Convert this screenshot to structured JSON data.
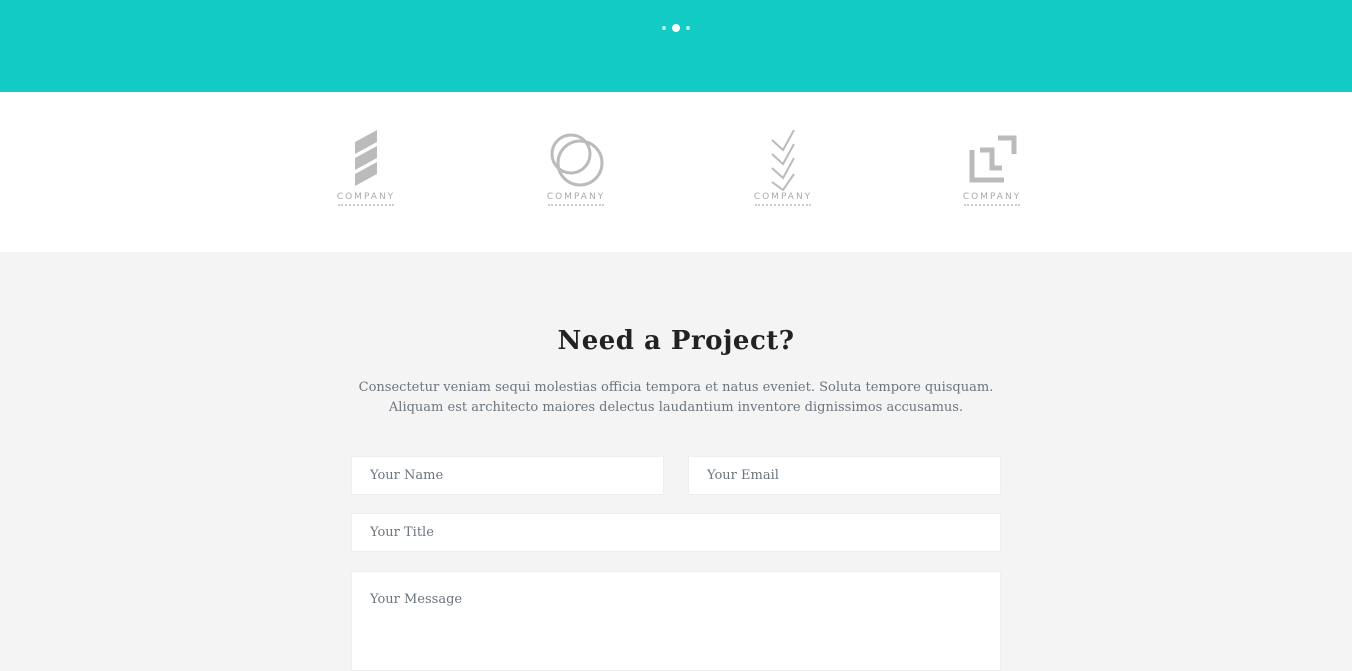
{
  "hero": {
    "background": "#12cbc4",
    "carousel_dots": [
      {
        "active": false
      },
      {
        "active": true
      },
      {
        "active": false
      }
    ]
  },
  "clients": {
    "logos": [
      {
        "name": "COMPANY",
        "icon": "stripes-logo-icon"
      },
      {
        "name": "COMPANY",
        "icon": "rings-logo-icon"
      },
      {
        "name": "COMPANY",
        "icon": "chevrons-logo-icon"
      },
      {
        "name": "COMPANY",
        "icon": "squares-logo-icon"
      }
    ]
  },
  "contact": {
    "title": "Need a Project?",
    "description_line1": "Consectetur veniam sequi molestias officia tempora et natus eveniet. Soluta tempore quisquam.",
    "description_line2": "Aliquam est architecto maiores delectus laudantium inventore dignissimos accusamus.",
    "name_placeholder": "Your Name",
    "email_placeholder": "Your Email",
    "title_placeholder": "Your Title",
    "message_placeholder": "Your Message"
  }
}
